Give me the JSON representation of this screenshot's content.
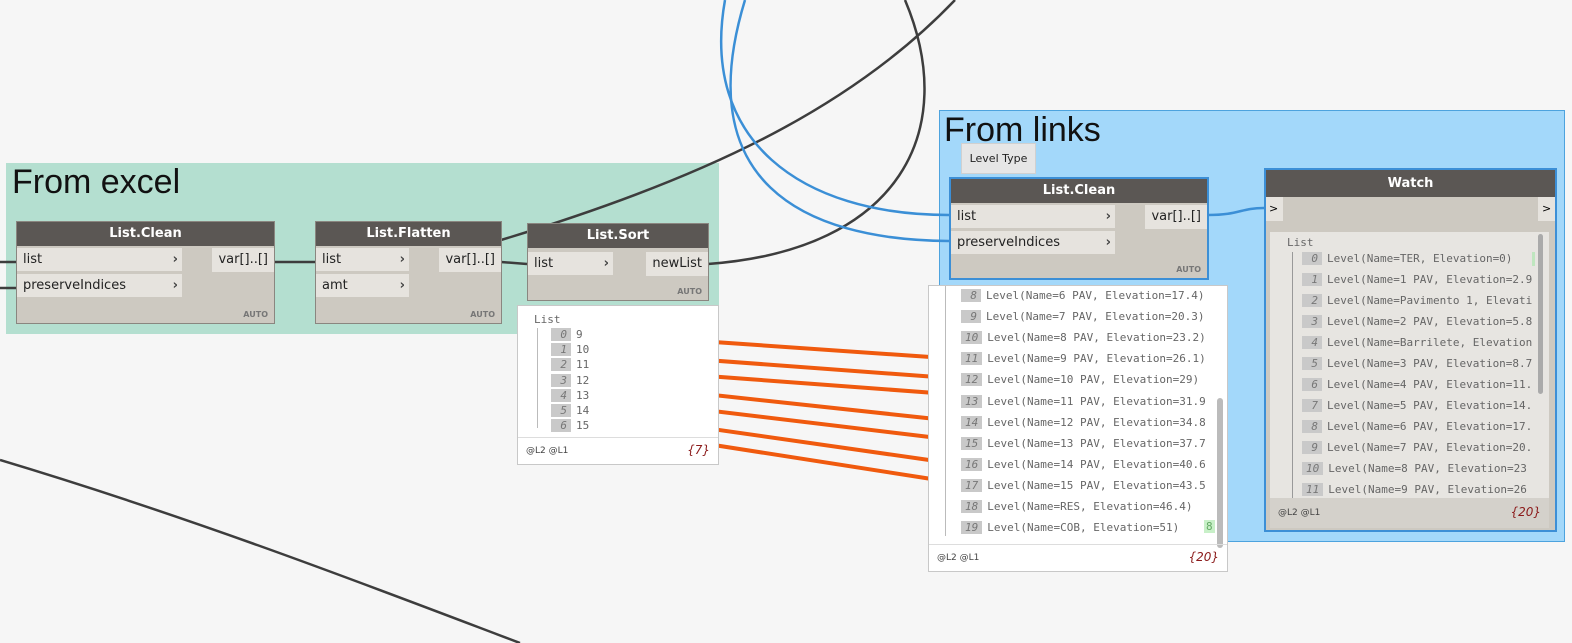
{
  "groups": {
    "excel": "From excel",
    "links": "From links"
  },
  "nodes": {
    "clean1": {
      "title": "List.Clean",
      "in": [
        "list",
        "preserveIndices"
      ],
      "out": "var[]..[]",
      "lacing": "AUTO"
    },
    "flatten": {
      "title": "List.Flatten",
      "in": [
        "list",
        "amt"
      ],
      "out": "var[]..[]",
      "lacing": "AUTO"
    },
    "sort": {
      "title": "List.Sort",
      "in": [
        "list"
      ],
      "out": "newList",
      "lacing": "AUTO"
    },
    "clean2": {
      "title": "List.Clean",
      "in": [
        "list",
        "preserveIndices"
      ],
      "out": "var[]..[]",
      "lacing": "AUTO",
      "tooltip": "Level Type"
    },
    "watch": {
      "title": "Watch",
      "in": ">",
      "out": ">"
    }
  },
  "sort_preview": {
    "header": "List",
    "items": [
      [
        "0",
        "9"
      ],
      [
        "1",
        "10"
      ],
      [
        "2",
        "11"
      ],
      [
        "3",
        "12"
      ],
      [
        "4",
        "13"
      ],
      [
        "5",
        "14"
      ],
      [
        "6",
        "15"
      ]
    ],
    "levels": "@L2 @L1",
    "count": "{7}"
  },
  "clean_preview": {
    "items": [
      [
        "8",
        "Level(Name=6 PAV, Elevation=17.4)"
      ],
      [
        "9",
        "Level(Name=7 PAV, Elevation=20.3)"
      ],
      [
        "10",
        "Level(Name=8 PAV, Elevation=23.2)"
      ],
      [
        "11",
        "Level(Name=9 PAV, Elevation=26.1)"
      ],
      [
        "12",
        "Level(Name=10 PAV, Elevation=29)"
      ],
      [
        "13",
        "Level(Name=11 PAV, Elevation=31.9"
      ],
      [
        "14",
        "Level(Name=12 PAV, Elevation=34.8"
      ],
      [
        "15",
        "Level(Name=13 PAV, Elevation=37.7"
      ],
      [
        "16",
        "Level(Name=14 PAV, Elevation=40.6"
      ],
      [
        "17",
        "Level(Name=15 PAV, Elevation=43.5"
      ],
      [
        "18",
        "Level(Name=RES, Elevation=46.4)"
      ],
      [
        "19",
        "Level(Name=COB, Elevation=51)"
      ]
    ],
    "badge": "8",
    "levels": "@L2 @L1",
    "count": "{20}"
  },
  "watch_preview": {
    "header": "List",
    "items": [
      [
        "0",
        "Level(Name=TER, Elevation=0)"
      ],
      [
        "1",
        "Level(Name=1 PAV, Elevation=2.9"
      ],
      [
        "2",
        "Level(Name=Pavimento 1, Elevati"
      ],
      [
        "3",
        "Level(Name=2 PAV, Elevation=5.8"
      ],
      [
        "4",
        "Level(Name=Barrilete, Elevation"
      ],
      [
        "5",
        "Level(Name=3 PAV, Elevation=8.7"
      ],
      [
        "6",
        "Level(Name=4 PAV, Elevation=11."
      ],
      [
        "7",
        "Level(Name=5 PAV, Elevation=14."
      ],
      [
        "8",
        "Level(Name=6 PAV, Elevation=17."
      ],
      [
        "9",
        "Level(Name=7 PAV, Elevation=20."
      ],
      [
        "10",
        "Level(Name=8 PAV, Elevation=23"
      ],
      [
        "11",
        "Level(Name=9 PAV, Elevation=26"
      ]
    ],
    "levels": "@L2 @L1",
    "count": "{20}"
  }
}
